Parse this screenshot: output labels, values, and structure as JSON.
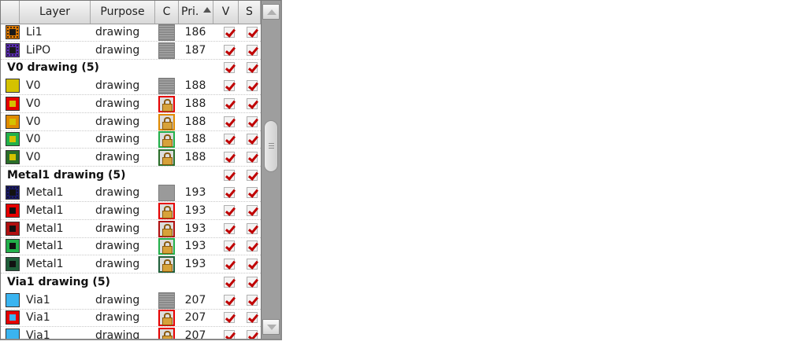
{
  "columns": {
    "layer": "Layer",
    "purpose": "Purpose",
    "c": "C",
    "priority": "Pri.",
    "v": "V",
    "s": "S"
  },
  "rows": [
    {
      "type": "layer",
      "name": "Li1",
      "purpose": "drawing",
      "priority": "186",
      "swatch": "#e07a00",
      "inner": "#1a1a1a",
      "pattern": "dots",
      "cicon": "gray",
      "border": "#333333"
    },
    {
      "type": "layer",
      "name": "LiPO",
      "purpose": "drawing",
      "priority": "187",
      "swatch": "#5a2bb0",
      "inner": "#1a1a1a",
      "pattern": "dots",
      "cicon": "gray",
      "border": "#333333"
    },
    {
      "type": "group",
      "label": "V0 drawing (5)"
    },
    {
      "type": "layer",
      "name": "V0",
      "purpose": "drawing",
      "priority": "188",
      "swatch": "#d4c200",
      "inner": null,
      "cicon": "gray",
      "border": "#333333"
    },
    {
      "type": "layer",
      "name": "V0",
      "purpose": "drawing",
      "priority": "188",
      "swatch": "#e60000",
      "inner": "#d4c200",
      "cicon": "lock-red",
      "border": "#e60000"
    },
    {
      "type": "layer",
      "name": "V0",
      "purpose": "drawing",
      "priority": "188",
      "swatch": "#e08a00",
      "inner": "#d4c200",
      "cicon": "lock-orange",
      "border": "#e08a00"
    },
    {
      "type": "layer",
      "name": "V0",
      "purpose": "drawing",
      "priority": "188",
      "swatch": "#22b04a",
      "inner": "#d4c200",
      "cicon": "lock-green",
      "border": "#22b04a"
    },
    {
      "type": "layer",
      "name": "V0",
      "purpose": "drawing",
      "priority": "188",
      "swatch": "#2a6e2a",
      "inner": "#d4c200",
      "cicon": "lock-darkgreen",
      "border": "#2a6e2a"
    },
    {
      "type": "group",
      "label": "Metal1 drawing (5)"
    },
    {
      "type": "layer",
      "name": "Metal1",
      "purpose": "drawing",
      "priority": "193",
      "swatch": "#1a1a6a",
      "inner": "#111111",
      "pattern": "dots",
      "cicon": "gray-solid",
      "border": "#1a1a6a"
    },
    {
      "type": "layer",
      "name": "Metal1",
      "purpose": "drawing",
      "priority": "193",
      "swatch": "#e60000",
      "inner": "#111111",
      "cicon": "lock-red",
      "border": "#e60000"
    },
    {
      "type": "layer",
      "name": "Metal1",
      "purpose": "drawing",
      "priority": "193",
      "swatch": "#b01010",
      "inner": "#111111",
      "cicon": "lock-darkred",
      "border": "#b01010"
    },
    {
      "type": "layer",
      "name": "Metal1",
      "purpose": "drawing",
      "priority": "193",
      "swatch": "#22b04a",
      "inner": "#111111",
      "cicon": "lock-green",
      "border": "#22b04a"
    },
    {
      "type": "layer",
      "name": "Metal1",
      "purpose": "drawing",
      "priority": "193",
      "swatch": "#1f5f3a",
      "inner": "#111111",
      "cicon": "lock-darkgreen",
      "border": "#1f5f3a"
    },
    {
      "type": "group",
      "label": "Via1 drawing (5)"
    },
    {
      "type": "layer",
      "name": "Via1",
      "purpose": "drawing",
      "priority": "207",
      "swatch": "#3ab4f0",
      "inner": null,
      "cicon": "gray",
      "border": "#3ab4f0"
    },
    {
      "type": "layer",
      "name": "Via1",
      "purpose": "drawing",
      "priority": "207",
      "swatch": "#e60000",
      "inner": "#3ab4f0",
      "cicon": "lock-red",
      "border": "#e60000"
    },
    {
      "type": "layer",
      "name": "Via1",
      "purpose": "drawing",
      "priority": "207",
      "swatch": "#3ab4f0",
      "inner": null,
      "cicon": "lock-red",
      "border": "#e60000"
    }
  ]
}
